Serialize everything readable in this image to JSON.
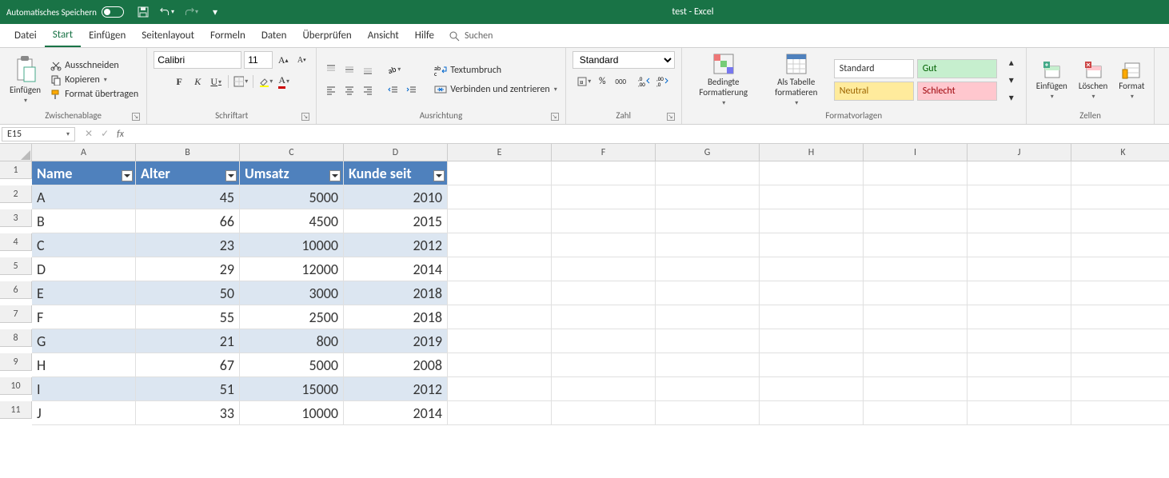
{
  "title": "test  -  Excel",
  "autoSave": "Automatisches Speichern",
  "tabs": [
    "Datei",
    "Start",
    "Einfügen",
    "Seitenlayout",
    "Formeln",
    "Daten",
    "Überprüfen",
    "Ansicht",
    "Hilfe"
  ],
  "activeTab": 1,
  "search": "Suchen",
  "clipboard": {
    "paste": "Einfügen",
    "cut": "Ausschneiden",
    "copy": "Kopieren",
    "formatPainter": "Format übertragen",
    "label": "Zwischenablage"
  },
  "font": {
    "name": "Calibri",
    "size": "11",
    "label": "Schriftart"
  },
  "alignment": {
    "wrap": "Textumbruch",
    "merge": "Verbinden und zentrieren",
    "label": "Ausrichtung"
  },
  "number": {
    "format": "Standard",
    "label": "Zahl"
  },
  "styles": {
    "cond": "Bedingte Formatierung",
    "asTable": "Als Tabelle formatieren",
    "s1": "Standard",
    "s2": "Gut",
    "s3": "Neutral",
    "s4": "Schlecht",
    "label": "Formatvorlagen"
  },
  "cells": {
    "insert": "Einfügen",
    "delete": "Löschen",
    "format": "Format",
    "label": "Zellen"
  },
  "nameBox": "E15",
  "columns": [
    "A",
    "B",
    "C",
    "D",
    "E",
    "F",
    "G",
    "H",
    "I",
    "J",
    "K"
  ],
  "rows": [
    "1",
    "2",
    "3",
    "4",
    "5",
    "6",
    "7",
    "8",
    "9",
    "10",
    "11"
  ],
  "table": {
    "headers": [
      "Name",
      "Alter",
      "Umsatz",
      "Kunde seit"
    ],
    "data": [
      [
        "A",
        "45",
        "5000",
        "2010"
      ],
      [
        "B",
        "66",
        "4500",
        "2015"
      ],
      [
        "C",
        "23",
        "10000",
        "2012"
      ],
      [
        "D",
        "29",
        "12000",
        "2014"
      ],
      [
        "E",
        "50",
        "3000",
        "2018"
      ],
      [
        "F",
        "55",
        "2500",
        "2018"
      ],
      [
        "G",
        "21",
        "800",
        "2019"
      ],
      [
        "H",
        "67",
        "5000",
        "2008"
      ],
      [
        "I",
        "51",
        "15000",
        "2012"
      ],
      [
        "J",
        "33",
        "10000",
        "2014"
      ]
    ]
  }
}
